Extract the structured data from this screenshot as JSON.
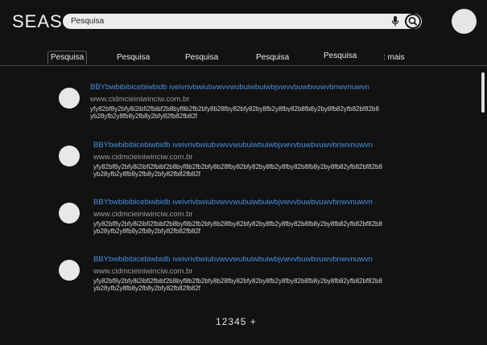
{
  "header": {
    "logo": "SEAS",
    "search": {
      "value": "Pesquisa",
      "placeholder": "Pesquisa"
    }
  },
  "tabs": [
    {
      "label": "Pesquisa"
    },
    {
      "label": "Pesquisa"
    },
    {
      "label": "Pesquisa"
    },
    {
      "label": "Pesquisa"
    },
    {
      "label": "Pesquisa"
    },
    {
      "label": ": mais"
    }
  ],
  "results": [
    {
      "title": "BBYbwbibibicebiwbidb iveivrivbwiubvwvvwubuiwbuiwbjvwvvbuwbvuwvbnwvnuwvn",
      "url": "www.cidmcieiniwinciw.com.br",
      "snippet_line1": "yfy82bf8y2bfy8i2ibfi2fbibf2b8byf8b2fb2bfy8b28fby82bfy82by8fb2y8fby82b8fb8y2by8fb82yfb82bf82b8",
      "snippet_line2": "yb28yfb2y8fb8y2fb8y2bfy82fb82fb82f"
    },
    {
      "title": "BBYbwbibibicebiwbidb iveivrivbwiubvwvvwubuiwbuiwbjvwvvbuwbvuwvbnwvnuwvn",
      "url": "www.cidmcieiniwinciw.com.br",
      "snippet_line1": "yfy82bf8y2bfy8i2ibfi2fbibf2b8byf8b2fb2bfy8b28fby82bfy82by8fb2y8fby82b8fb8y2by8fb82yfb82bf82b8",
      "snippet_line2": "yb28yfb2y8fb8y2fb8y2bfy82fb82fb82f"
    },
    {
      "title": "BBYbwbibibicebiwbidb iveivrivbwiubvwvvwubuiwbuiwbjvwvvbuwbvuwvbnwvnuwvn",
      "url": "www.cidmcieiniwinciw.com.br",
      "snippet_line1": "yfy82bf8y2bfy8i2ibfi2fbibf2b8byf8b2fb2bfy8b28fby82bfy82by8fb2y8fby82b8fb8y2by8fb82yfb82bf82b8",
      "snippet_line2": "yb28yfb2y8fb8y2fb8y2bfy82fb82fb82f"
    },
    {
      "title": "BBYbwbibibicebiwbidb iveivrivbwiubvwvvwubuiwbuiwbjvwvvbuwbvuwvbnwvnuwvn",
      "url": "www.cidmcieiniwinciw.com.br",
      "snippet_line1": "yfy82bf8y2bfy8i2ibfi2fbibf2b8byf8b2fb2bfy8b28fby82bfy82by8fb2y8fby82b8fb8y2by8fb82yfb82bf82b8",
      "snippet_line2": "yb28yfb2y8fb8y2fb8y2bfy82fb82fb82f"
    }
  ],
  "pagination": [
    "1",
    "2",
    "3",
    "4",
    "5",
    "+"
  ],
  "colors": {
    "background": "#121212",
    "link": "#4a90e2",
    "url": "#9a9a9a",
    "search_bar": "#ececec"
  },
  "icons": {
    "mic": "mic-icon",
    "search": "search-icon",
    "avatar": "avatar"
  }
}
